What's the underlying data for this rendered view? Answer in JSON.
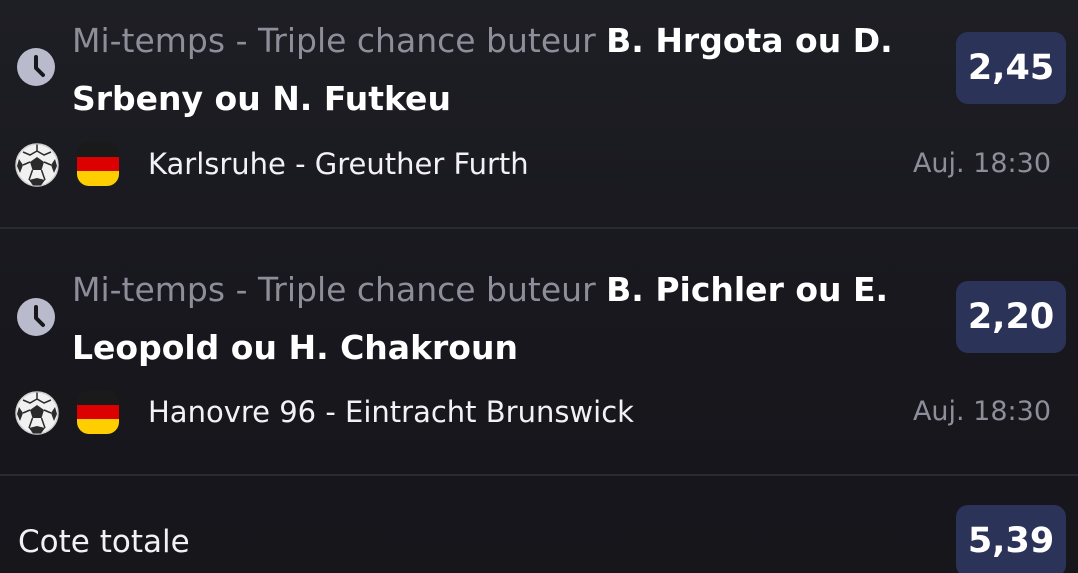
{
  "bets": [
    {
      "market_prefix": "Mi-temps - Triple chance buteur",
      "selection_line1": "B. Hrgota ou D.",
      "selection_line2": "Srbeny ou N. Futkeu",
      "odds": "2,45",
      "match": "Karlsruhe - Greuther Furth",
      "time": "Auj. 18:30",
      "sport_icon": "soccer-ball-icon",
      "country_flag": "germany-flag-icon"
    },
    {
      "market_prefix": "Mi-temps - Triple chance buteur",
      "selection_line1": "B. Pichler ou E.",
      "selection_line2": "Leopold ou H. Chakroun",
      "odds": "2,20",
      "match": "Hanovre 96 - Eintracht Brunswick",
      "time": "Auj. 18:30",
      "sport_icon": "soccer-ball-icon",
      "country_flag": "germany-flag-icon"
    }
  ],
  "total": {
    "label": "Cote totale",
    "odds": "5,39"
  },
  "colors": {
    "background": "#17171c",
    "odds_badge": "#2c3358",
    "muted_text": "#8d8e99",
    "clock_icon": "#b9bbcc",
    "flag_black": "#1a1a1a",
    "flag_red": "#dd0000",
    "flag_gold": "#ffce00"
  }
}
